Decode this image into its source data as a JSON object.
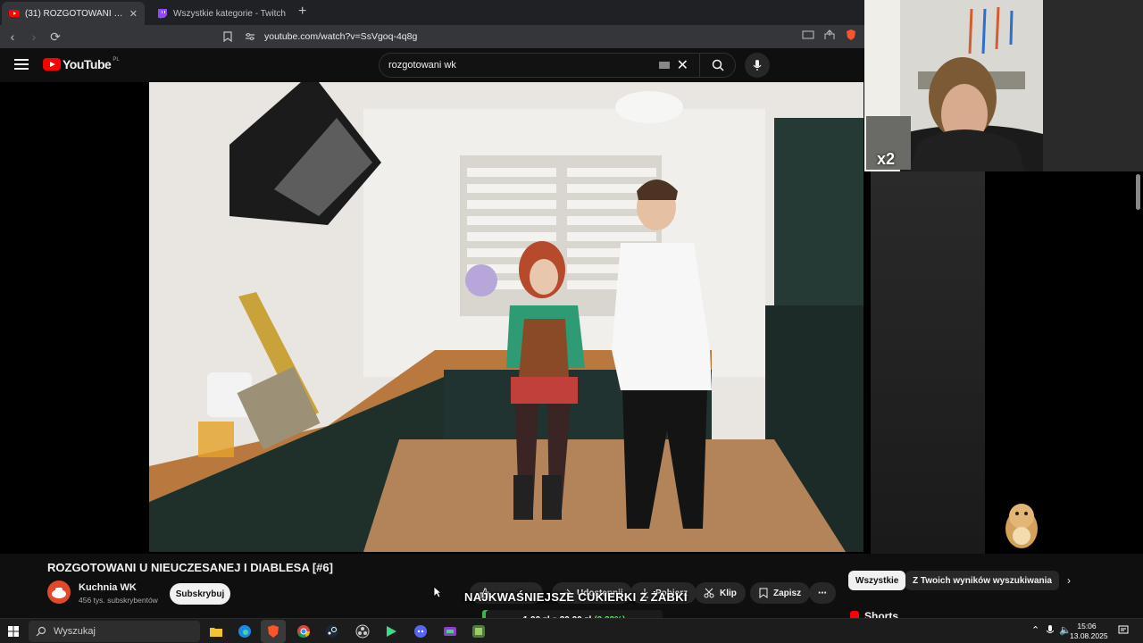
{
  "browser": {
    "tabs": [
      {
        "label": "(31) ROZGOTOWANI U NIEUCZESANEJ I DIABLESA [#6]",
        "active": true,
        "icon": "youtube-favicon"
      },
      {
        "label": "Wszystkie kategorie - Twitch",
        "active": false,
        "icon": "twitch-favicon"
      }
    ],
    "new_tab": "+",
    "url": "youtube.com/watch?v=SsVgoq-4q8g"
  },
  "youtube": {
    "logo_text": "YouTube",
    "region": "PL",
    "search_value": "rozgotowani wk",
    "video": {
      "title": "ROZGOTOWANI U NIEUCZESANEJ I DIABLESA [#6]",
      "channel_name": "Kuchnia WK",
      "subscribers": "456 tys. subskrybentów",
      "subscribe_label": "Subskrybuj",
      "actions": [
        "Udostępnij",
        "Pobierz",
        "Klip",
        "Zapisz"
      ]
    },
    "chips": [
      "Wszystkie",
      "Z Twoich wyników wyszukiwania"
    ],
    "shorts_label": "Shorts"
  },
  "overlay": {
    "webcam_badge": "x2",
    "banner_title": "NAJKWAŚNIEJSZE CUKIERKI Z ŻABKI",
    "goal_current": "1,00 zł",
    "goal_sep": "z",
    "goal_target": "30,00 zł",
    "goal_percent": "(3.33%)",
    "goal_progress": 0.0333
  },
  "taskbar": {
    "search_placeholder": "Wyszukaj",
    "time": "15:06",
    "date": "13.08.2025"
  },
  "colors": {
    "youtube_red": "#ff0000",
    "background": "#0f0f0f",
    "goal_green": "#5ee35e"
  }
}
